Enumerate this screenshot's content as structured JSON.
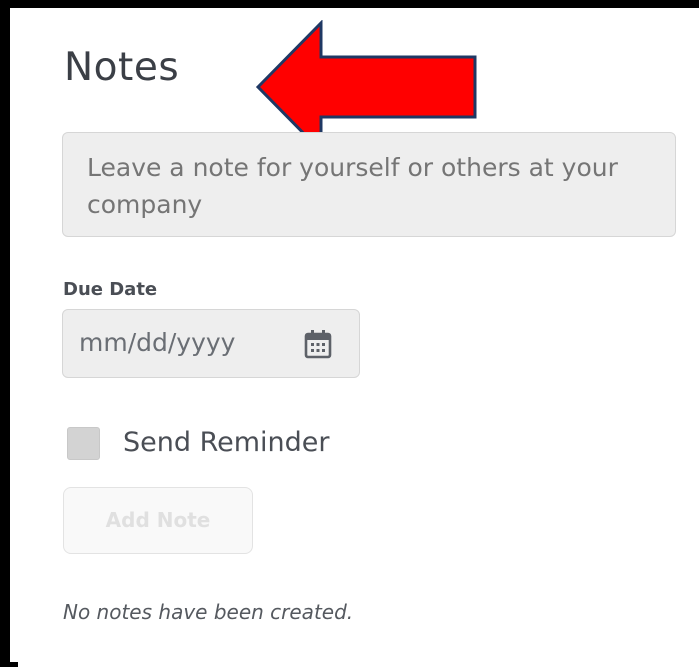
{
  "notes": {
    "title": "Notes",
    "note_placeholder": "Leave a note for yourself or others at your company",
    "due_date_label": "Due Date",
    "date_placeholder": "mm/dd/yyyy",
    "send_reminder_label": "Send Reminder",
    "send_reminder_checked": false,
    "add_note_label": "Add Note",
    "empty_state": "No notes have been created."
  },
  "annotation": {
    "arrow_color": "#ff0000",
    "arrow_outline_color": "#1f3864"
  },
  "icons": {
    "date_picker": "calendar-icon"
  }
}
